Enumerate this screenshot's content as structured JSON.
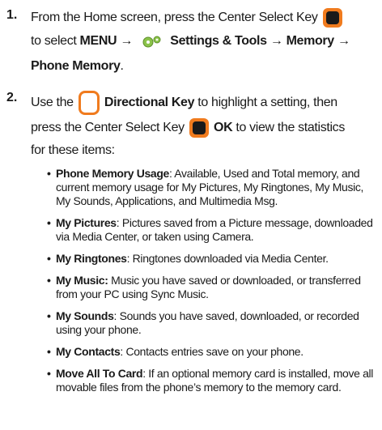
{
  "step1": {
    "number": "1.",
    "text_intro": "From the Home screen, press the Center Select Key",
    "text_to_select": "to select",
    "menu": "MENU",
    "arrow": "→",
    "settings": "Settings & Tools",
    "memory": "Memory",
    "phone_memory": "Phone Memory",
    "period": "."
  },
  "step2": {
    "number": "2.",
    "use_the": "Use the",
    "directional_key": "Directional Key",
    "highlight": "to highlight a setting, then",
    "press_center": "press the Center Select Key",
    "ok": "OK",
    "view_stats": "to view the statistics",
    "for_items": "for these items:"
  },
  "bullets": [
    {
      "title": "Phone Memory Usage",
      "lines": [
        ": Available, Used and Total memory, and",
        "current memory usage for My Pictures, My Ringtones, My Music,",
        "My Sounds, Applications, and Multimedia Msg."
      ]
    },
    {
      "title": "My Pictures",
      "lines": [
        ": Pictures saved from a Picture message, downloaded",
        "via Media Center, or taken using Camera."
      ]
    },
    {
      "title": "My Ringtones",
      "lines": [
        ": Ringtones downloaded via Media Center."
      ]
    },
    {
      "title": "My Music:",
      "lines": [
        " Music you have saved or downloaded, or transferred",
        "from your PC using Sync Music."
      ]
    },
    {
      "title": "My Sounds",
      "lines": [
        ": Sounds you have saved, downloaded, or recorded",
        "using your phone."
      ]
    },
    {
      "title": "My Contacts",
      "lines": [
        ": Contacts entries save on your phone."
      ]
    },
    {
      "title": "Move All To Card",
      "lines": [
        ": If an optional memory card is installed, move all",
        "movable files from the phone’s memory to the memory card."
      ]
    }
  ],
  "bullet_symbol": "•",
  "icons": {
    "center_select_key": "center-select-key-icon",
    "settings_gear": "settings-gear-icon",
    "directional_key": "directional-key-icon"
  },
  "colors": {
    "accent": "#f07b1e",
    "key_fill": "#1a1a1a",
    "gear": "#8bc34a"
  }
}
